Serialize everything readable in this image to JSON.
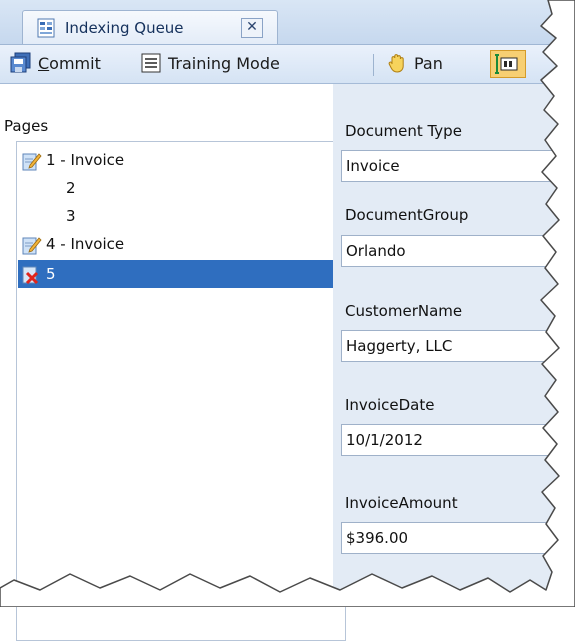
{
  "tab": {
    "title": "Indexing Queue",
    "close_glyph": "✕",
    "icon": "indexing-queue-icon"
  },
  "toolbar": {
    "commit_key": "C",
    "commit_rest": "ommit",
    "training_label": "Training Mode",
    "pan_label": "Pan"
  },
  "pages": {
    "title": "Pages",
    "items": [
      {
        "label": "1 - Invoice",
        "icon": "edit-document-icon",
        "selected": false
      },
      {
        "label": "2",
        "icon": "",
        "selected": false
      },
      {
        "label": "3",
        "icon": "",
        "selected": false
      },
      {
        "label": "4 - Invoice",
        "icon": "edit-document-icon",
        "selected": false
      },
      {
        "label": "5",
        "icon": "error-document-icon",
        "selected": true
      }
    ]
  },
  "fields": [
    {
      "label": "Document Type",
      "value": "Invoice"
    },
    {
      "label": "DocumentGroup",
      "value": "Orlando"
    },
    {
      "label": "CustomerName",
      "value": "Haggerty, LLC"
    },
    {
      "label": "InvoiceDate",
      "value": "10/1/2012"
    },
    {
      "label": "InvoiceAmount",
      "value": "$396.00"
    }
  ],
  "colors": {
    "selection": "#2f6ebf",
    "panel": "#e3ebf5",
    "toolbar": "#dde8f6"
  }
}
